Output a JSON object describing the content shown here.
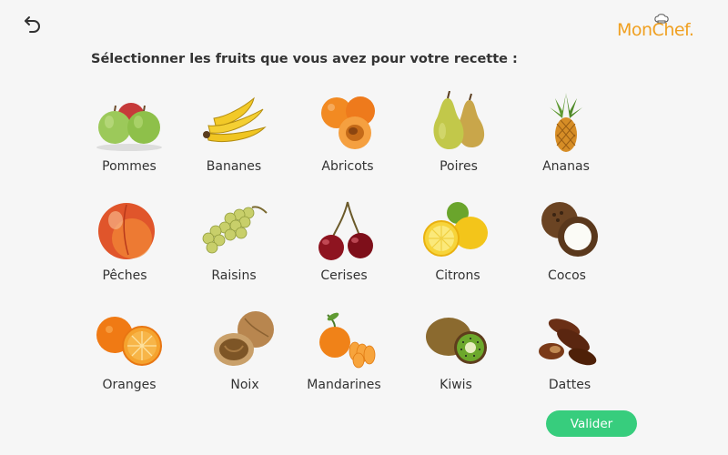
{
  "header": {
    "back_icon": "undo-arrow-icon",
    "logo_text": "MonChef.",
    "logo_icon": "chef-hat-icon"
  },
  "instruction": "Sélectionner les fruits que vous avez pour votre recette :",
  "fruits": [
    {
      "label": "Pommes",
      "icon": "apples-icon"
    },
    {
      "label": "Bananes",
      "icon": "bananas-icon"
    },
    {
      "label": "Abricots",
      "icon": "apricots-icon"
    },
    {
      "label": "Poires",
      "icon": "pears-icon"
    },
    {
      "label": "Ananas",
      "icon": "pineapple-icon"
    },
    {
      "label": "Pêches",
      "icon": "peach-icon"
    },
    {
      "label": "Raisins",
      "icon": "grapes-icon"
    },
    {
      "label": "Cerises",
      "icon": "cherries-icon"
    },
    {
      "label": "Citrons",
      "icon": "lemons-icon"
    },
    {
      "label": "Cocos",
      "icon": "coconut-icon"
    },
    {
      "label": "Oranges",
      "icon": "oranges-icon"
    },
    {
      "label": "Noix",
      "icon": "walnuts-icon"
    },
    {
      "label": "Mandarines",
      "icon": "mandarins-icon"
    },
    {
      "label": "Kiwis",
      "icon": "kiwis-icon"
    },
    {
      "label": "Dattes",
      "icon": "dates-icon"
    }
  ],
  "validate_label": "Valider",
  "colors": {
    "background": "#f6f6f6",
    "brand_orange": "#f0a021",
    "validate_green": "#37cd7d"
  }
}
